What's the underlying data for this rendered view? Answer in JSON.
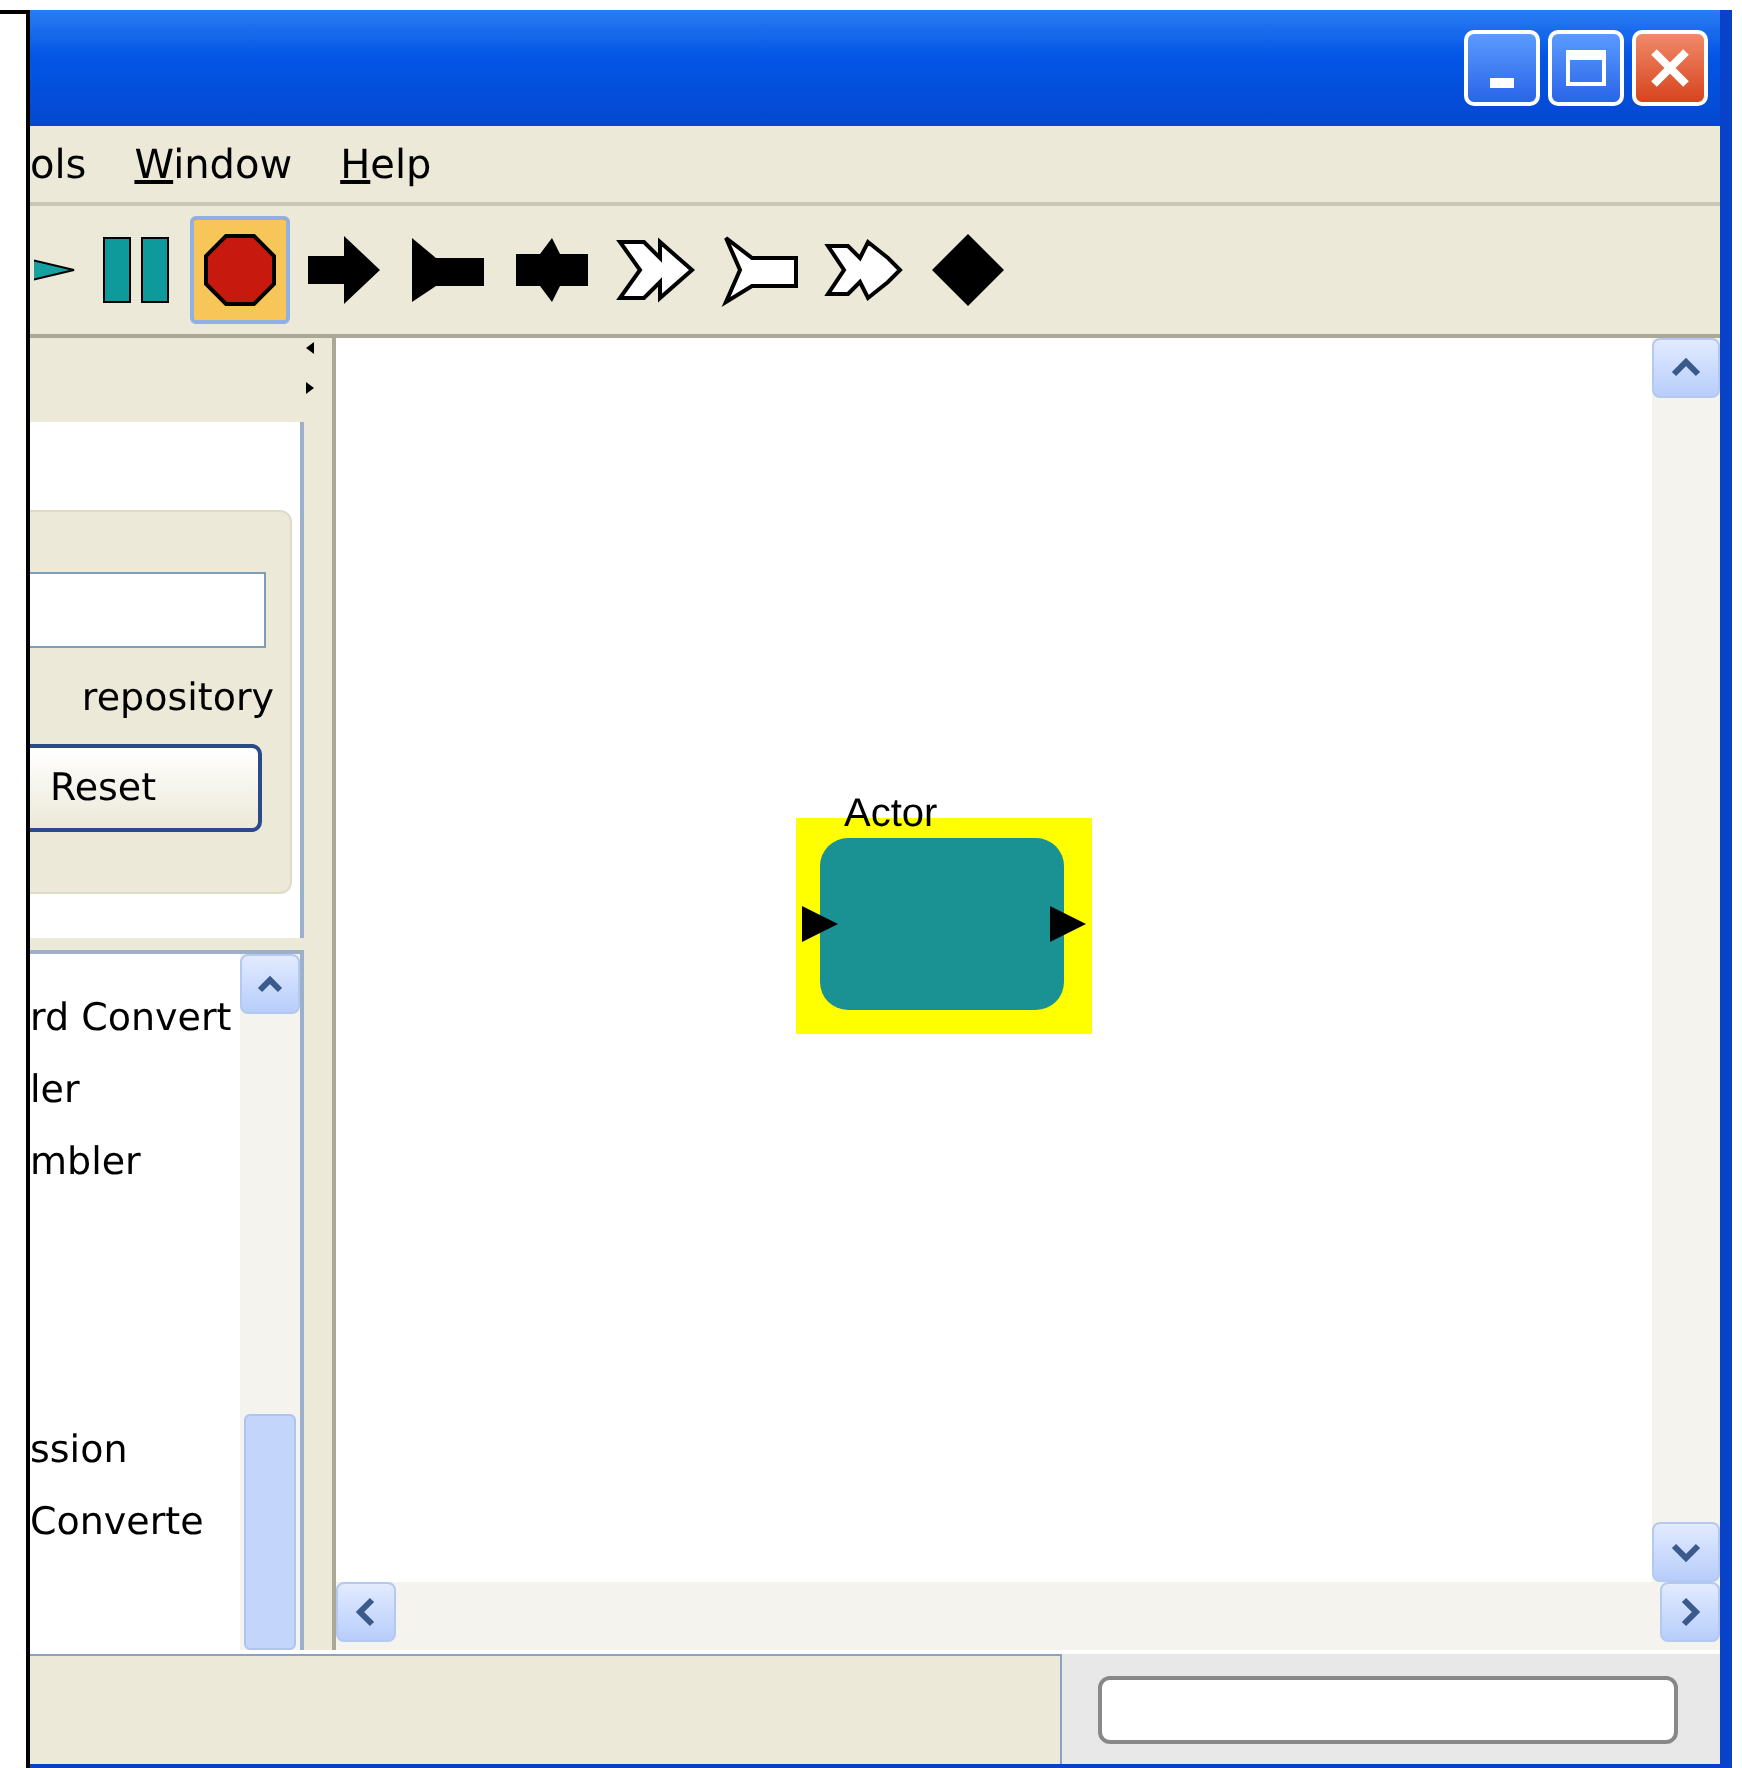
{
  "window": {
    "controls": [
      {
        "kind": "minimize"
      },
      {
        "kind": "maximize"
      },
      {
        "kind": "close"
      }
    ]
  },
  "menu": [
    {
      "label": "ols",
      "mnemonic": false
    },
    {
      "label": "Window",
      "mnemonic": true
    },
    {
      "label": "Help",
      "mnemonic": true
    }
  ],
  "toolbar": [
    {
      "kind": "play",
      "selected": false
    },
    {
      "kind": "pause",
      "selected": false
    },
    {
      "kind": "stop",
      "selected": true
    },
    {
      "kind": "arrow",
      "selected": false
    },
    {
      "kind": "flag",
      "selected": false
    },
    {
      "kind": "notch",
      "selected": false
    },
    {
      "kind": "double-outline",
      "selected": false
    },
    {
      "kind": "flag-outline",
      "selected": false
    },
    {
      "kind": "notch-outline",
      "selected": false
    },
    {
      "kind": "diamond",
      "selected": false
    }
  ],
  "search_panel": {
    "option_label": "repository",
    "reset_button": "Reset"
  },
  "library": {
    "groups": [
      [
        "rd Convert",
        "ler",
        "mbler"
      ],
      [
        "ssion",
        "Converte"
      ]
    ]
  },
  "canvas": {
    "actors": [
      {
        "label": "Actor",
        "selected": true,
        "color": "#1a9294"
      }
    ]
  }
}
